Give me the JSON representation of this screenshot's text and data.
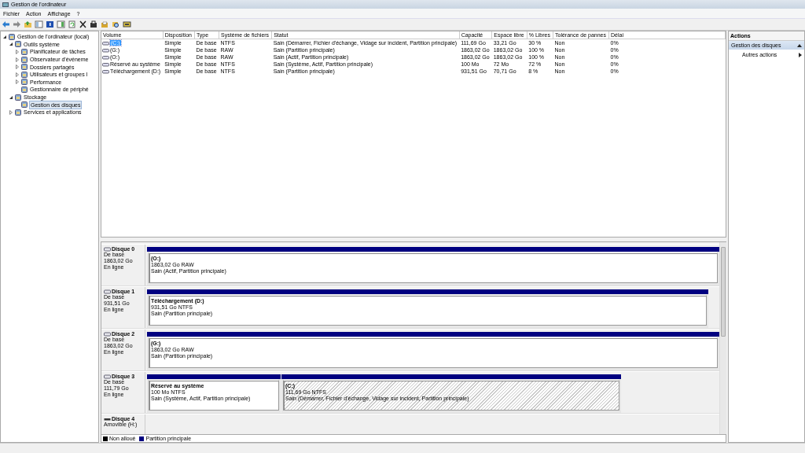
{
  "window": {
    "title": "Gestion de l'ordinateur"
  },
  "menu": [
    "Fichier",
    "Action",
    "Affichage",
    "?"
  ],
  "tree": [
    {
      "label": "Gestion de l'ordinateur (local)",
      "expanded": true,
      "selected": false,
      "children": [
        {
          "label": "Outils système",
          "expanded": true,
          "selected": false,
          "children": [
            {
              "label": "Planificateur de tâches",
              "expanded": false,
              "selected": false
            },
            {
              "label": "Observateur d'événeme",
              "expanded": false,
              "selected": false
            },
            {
              "label": "Dossiers partagés",
              "expanded": false,
              "selected": false
            },
            {
              "label": "Utilisateurs et groupes l",
              "expanded": false,
              "selected": false
            },
            {
              "label": "Performance",
              "expanded": false,
              "selected": false
            },
            {
              "label": "Gestionnaire de périphé",
              "selected": false
            }
          ]
        },
        {
          "label": "Stockage",
          "expanded": true,
          "selected": false,
          "children": [
            {
              "label": "Gestion des disques",
              "selected": true
            }
          ]
        },
        {
          "label": "Services et applications",
          "expanded": false,
          "selected": false
        }
      ]
    }
  ],
  "table": {
    "columns": [
      "Volume",
      "Disposition",
      "Type",
      "Système de fichiers",
      "Statut",
      "Capacité",
      "Espace libre",
      "% Libres",
      "Tolérance de pannes",
      "Délai"
    ],
    "rows": [
      {
        "selected": true,
        "cells": [
          "(C:)",
          "Simple",
          "De base",
          "NTFS",
          "Sain (Démarrer, Fichier d'échange, Vidage sur incident, Partition principale)",
          "111,69 Go",
          "33,21 Go",
          "30 %",
          "Non",
          "0%"
        ]
      },
      {
        "selected": false,
        "cells": [
          "(G:)",
          "Simple",
          "De base",
          "RAW",
          "Sain (Partition principale)",
          "1863,02 Go",
          "1863,02 Go",
          "100 %",
          "Non",
          "0%"
        ]
      },
      {
        "selected": false,
        "cells": [
          "(O:)",
          "Simple",
          "De base",
          "RAW",
          "Sain (Actif, Partition principale)",
          "1863,02 Go",
          "1863,02 Go",
          "100 %",
          "Non",
          "0%"
        ]
      },
      {
        "selected": false,
        "cells": [
          "Réservé au système",
          "Simple",
          "De base",
          "NTFS",
          "Sain (Système, Actif, Partition principale)",
          "100 Mo",
          "72 Mo",
          "72 %",
          "Non",
          "0%"
        ]
      },
      {
        "selected": false,
        "cells": [
          "Téléchargement (D:)",
          "Simple",
          "De base",
          "NTFS",
          "Sain (Partition principale)",
          "931,51 Go",
          "70,71 Go",
          "8 %",
          "Non",
          "0%"
        ]
      }
    ]
  },
  "disks": [
    {
      "name": "Disque 0",
      "kind": "fixed",
      "lines": [
        "De base",
        "1863,02 Go",
        "En ligne"
      ],
      "partitions": [
        {
          "name": "(O:)",
          "size": "1863,02 Go RAW",
          "status": "Sain (Actif, Partition principale)",
          "selected": false
        }
      ]
    },
    {
      "name": "Disque 1",
      "kind": "fixed",
      "lines": [
        "De base",
        "931,51 Go",
        "En ligne"
      ],
      "partitions": [
        {
          "name": "Téléchargement  (D:)",
          "size": "931,51 Go NTFS",
          "status": "Sain (Partition principale)",
          "selected": false
        }
      ]
    },
    {
      "name": "Disque 2",
      "kind": "fixed",
      "lines": [
        "De base",
        "1863,02 Go",
        "En ligne"
      ],
      "partitions": [
        {
          "name": "(G:)",
          "size": "1863,02 Go RAW",
          "status": "Sain (Partition principale)",
          "selected": false
        }
      ]
    },
    {
      "name": "Disque 3",
      "kind": "fixed",
      "lines": [
        "De base",
        "111,79 Go",
        "En ligne"
      ],
      "partitions": [
        {
          "name": "Réservé au système",
          "size": "100 Mo NTFS",
          "status": "Sain (Système, Actif, Partition principale)",
          "selected": false
        },
        {
          "name": "(C:)",
          "size": "111,69 Go NTFS",
          "status": "Sain (Démarrer, Fichier d'échange, Vidage sur incident, Partition principale)",
          "selected": true
        }
      ]
    },
    {
      "name": "Disque 4",
      "kind": "removable",
      "lines": [
        "Amovible (H:)"
      ]
    }
  ],
  "legend": [
    {
      "label": "Non alloué",
      "color": "#000000"
    },
    {
      "label": "Partition principale",
      "color": "#000080"
    }
  ],
  "actions": {
    "title": "Actions",
    "section": "Gestion des disques",
    "items": [
      "Autres actions"
    ]
  }
}
